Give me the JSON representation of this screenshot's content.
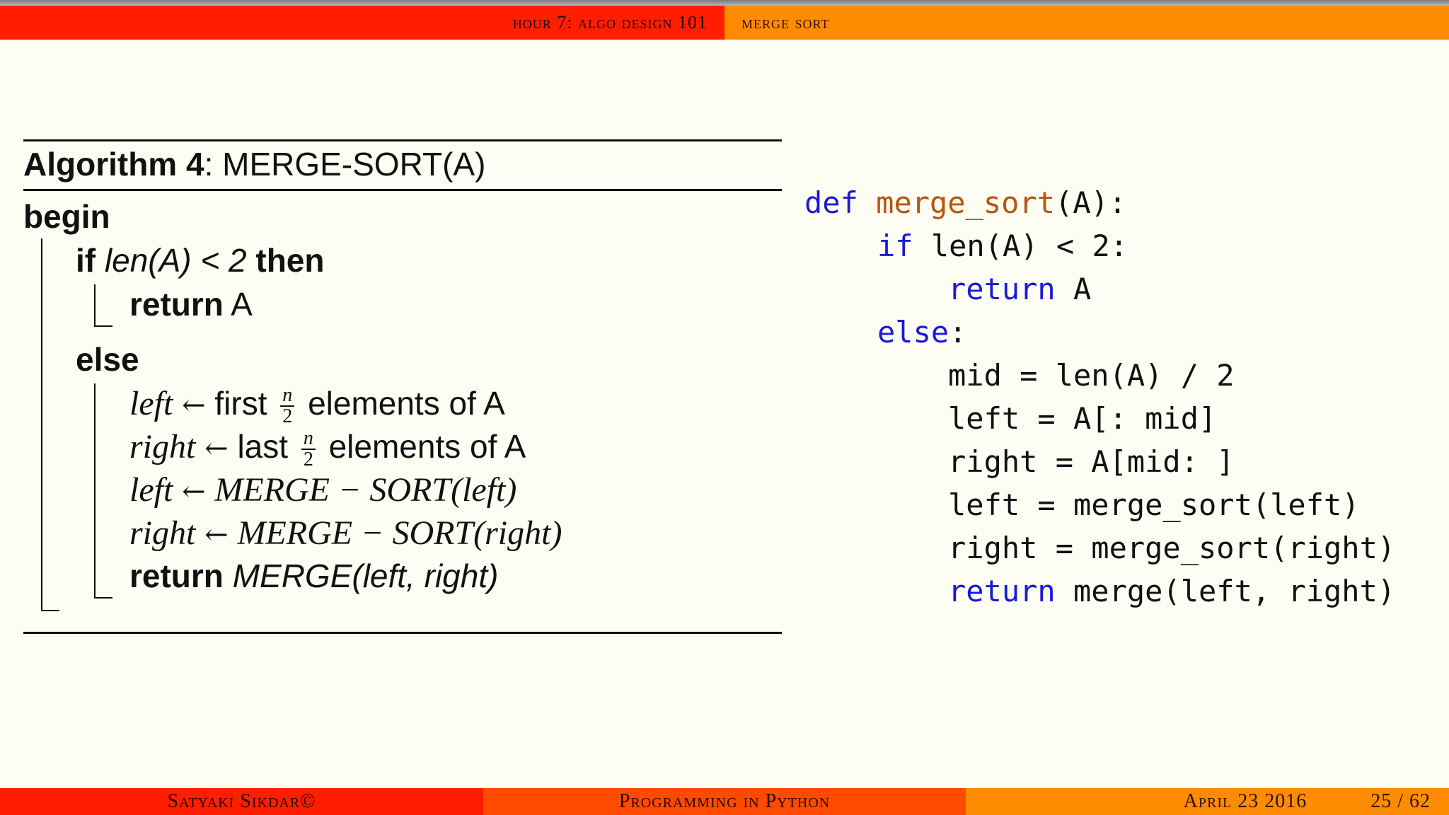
{
  "header": {
    "section": "hour 7: algo design 101",
    "subsection": "merge sort"
  },
  "algorithm": {
    "label": "Algorithm 4",
    "name": ": MERGE-SORT(A)",
    "begin": "begin",
    "if_kw": "if",
    "if_cond": "len(A) < 2",
    "then_kw": "then",
    "return_kw": "return",
    "return_a": "A",
    "else_kw": "else",
    "left_var": "left",
    "right_var": "right",
    "first_text": "first",
    "last_text": "last",
    "frac_num": "n",
    "frac_den": "2",
    "elements_of": "elements of A",
    "merge_sort_left": "MERGE − SORT",
    "arg_left": "(left)",
    "arg_right": "(right)",
    "merge_call": "MERGE(left, right)"
  },
  "code": {
    "line1_def": "def",
    "line1_name": "merge_sort",
    "line1_rest": "(A):",
    "line2_kw": "if",
    "line2_rest": " len(A) < 2:",
    "line3_kw": "return",
    "line3_rest": " A",
    "line4_kw": "else",
    "line4_rest": ":",
    "line5": "mid = len(A) / 2",
    "line6": "left = A[: mid]",
    "line7": "right = A[mid: ]",
    "line8": "left = merge_sort(left)",
    "line9": "right = merge_sort(right)",
    "line10_kw": "return",
    "line10_rest": " merge(left, right)"
  },
  "footer": {
    "author": "Satyaki Sikdar©",
    "course": "Programming in Python",
    "date": "April 23 2016",
    "page": "25 / 62"
  }
}
